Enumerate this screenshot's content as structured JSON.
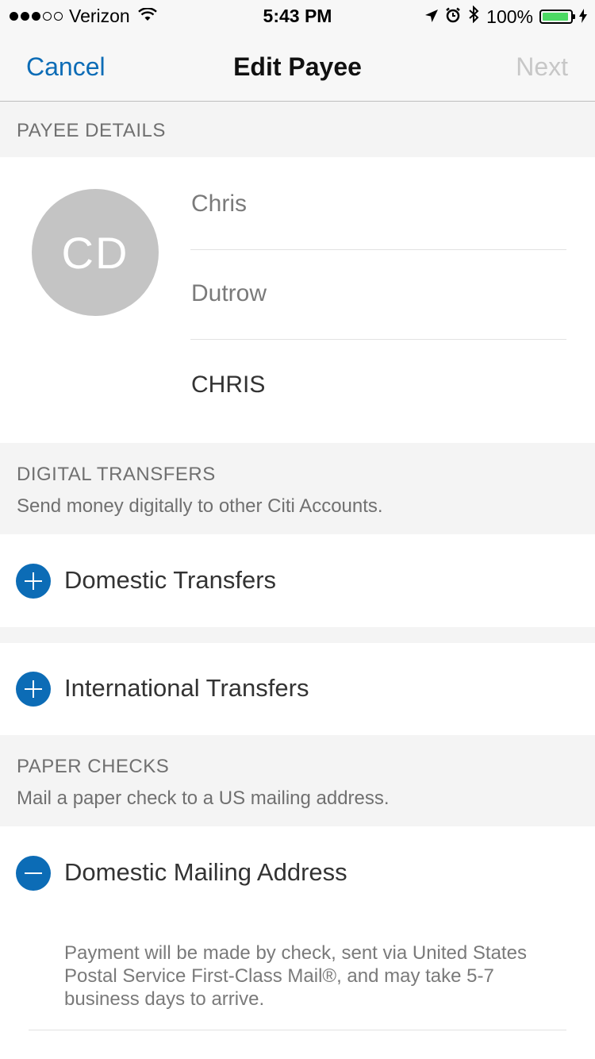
{
  "status_bar": {
    "carrier": "Verizon",
    "time": "5:43 PM",
    "battery": "100%"
  },
  "nav": {
    "cancel": "Cancel",
    "title": "Edit Payee",
    "next": "Next"
  },
  "payee_details": {
    "header": "PAYEE DETAILS",
    "initials": "CD",
    "first_name": "Chris",
    "last_name": "Dutrow",
    "nickname": "CHRIS"
  },
  "digital_transfers": {
    "header": "DIGITAL TRANSFERS",
    "description": "Send money digitally to other Citi Accounts.",
    "domestic": "Domestic Transfers",
    "international": "International Transfers"
  },
  "paper_checks": {
    "header": "PAPER CHECKS",
    "description": "Mail a paper check to a US mailing address.",
    "domestic_mailing": "Domestic Mailing Address",
    "note": "Payment will be made by check, sent via United States Postal Service First-Class Mail®, and may take 5-7 business days to arrive."
  },
  "colors": {
    "accent": "#0c6cb6",
    "disabled": "#c7c7c7",
    "battery_fill": "#4cd964",
    "section_bg": "#f4f4f4"
  },
  "icons": {
    "add": "plus-circle-icon",
    "remove": "minus-circle-icon"
  }
}
